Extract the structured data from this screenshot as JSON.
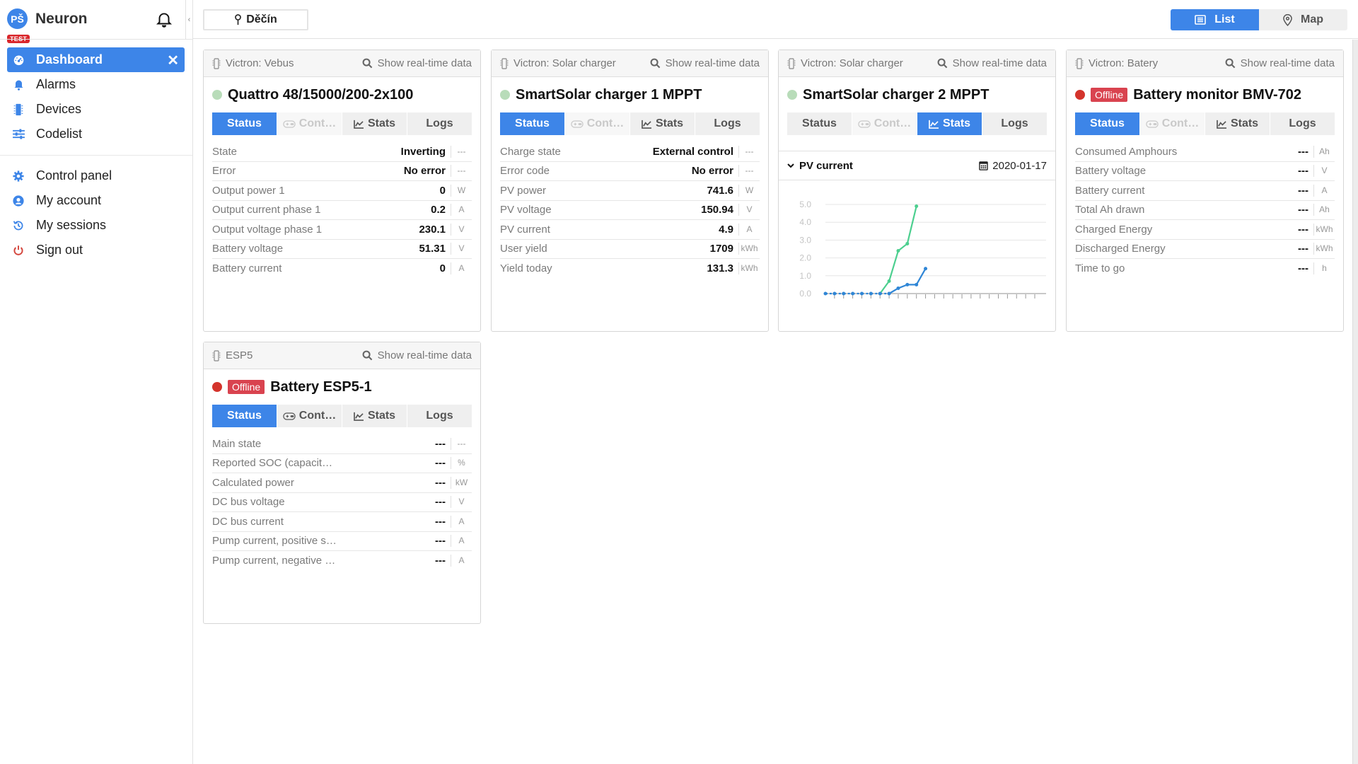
{
  "sidebar": {
    "avatar_initials": "PŠ",
    "brand": "Neuron",
    "env_badge": "TEST",
    "collapse_glyph": "‹",
    "nav_main": [
      {
        "label": "Dashboard",
        "icon": "dashboard-icon",
        "active": true,
        "close": "✕"
      },
      {
        "label": "Alarms",
        "icon": "bell-icon"
      },
      {
        "label": "Devices",
        "icon": "chip-icon"
      },
      {
        "label": "Codelist",
        "icon": "sliders-icon"
      }
    ],
    "nav_account": [
      {
        "label": "Control panel",
        "icon": "gear-icon"
      },
      {
        "label": "My account",
        "icon": "user-circle-icon"
      },
      {
        "label": "My sessions",
        "icon": "history-icon"
      },
      {
        "label": "Sign out",
        "icon": "power-icon"
      }
    ]
  },
  "topbar": {
    "location": "Děčín",
    "views": [
      {
        "label": "List",
        "active": true
      },
      {
        "label": "Map",
        "active": false
      }
    ]
  },
  "colors": {
    "accent": "#3d85e8",
    "online": "#b8dcb9",
    "offline": "#d4342c",
    "series_green": "#4ccf8f",
    "series_blue": "#2f86d6"
  },
  "realtime_label": "Show real-time data",
  "tab_labels": [
    "Status",
    "Cont…",
    "Stats",
    "Logs"
  ],
  "cards": [
    {
      "type": "Victron: Vebus",
      "name": "Quattro 48/15000/200-2x100",
      "status": "online",
      "active_tab": "Status",
      "control_enabled": false,
      "rows": [
        {
          "label": "State",
          "value": "Inverting",
          "unit": "---"
        },
        {
          "label": "Error",
          "value": "No error",
          "unit": "---"
        },
        {
          "label": "Output power 1",
          "value": "0",
          "unit": "W"
        },
        {
          "label": "Output current phase 1",
          "value": "0.2",
          "unit": "A"
        },
        {
          "label": "Output voltage phase 1",
          "value": "230.1",
          "unit": "V"
        },
        {
          "label": "Battery voltage",
          "value": "51.31",
          "unit": "V"
        },
        {
          "label": "Battery current",
          "value": "0",
          "unit": "A"
        }
      ]
    },
    {
      "type": "Victron: Solar charger",
      "name": "SmartSolar charger 1 MPPT",
      "status": "online",
      "active_tab": "Status",
      "control_enabled": false,
      "rows": [
        {
          "label": "Charge state",
          "value": "External control",
          "unit": "---"
        },
        {
          "label": "Error code",
          "value": "No error",
          "unit": "---"
        },
        {
          "label": "PV power",
          "value": "741.6",
          "unit": "W"
        },
        {
          "label": "PV voltage",
          "value": "150.94",
          "unit": "V"
        },
        {
          "label": "PV current",
          "value": "4.9",
          "unit": "A"
        },
        {
          "label": "User yield",
          "value": "1709",
          "unit": "kWh"
        },
        {
          "label": "Yield today",
          "value": "131.3",
          "unit": "kWh"
        }
      ]
    },
    {
      "type": "Victron: Solar charger",
      "name": "SmartSolar charger 2 MPPT",
      "status": "online",
      "active_tab": "Stats",
      "control_enabled": false,
      "stats": {
        "metric": "PV current",
        "date": "2020-01-17"
      }
    },
    {
      "type": "Victron: Batery",
      "name": "Battery monitor BMV-702",
      "status": "offline",
      "status_label": "Offline",
      "active_tab": "Status",
      "control_enabled": false,
      "rows": [
        {
          "label": "Consumed Amphours",
          "value": "---",
          "unit": "Ah"
        },
        {
          "label": "Battery voltage",
          "value": "---",
          "unit": "V"
        },
        {
          "label": "Battery current",
          "value": "---",
          "unit": "A"
        },
        {
          "label": "Total Ah drawn",
          "value": "---",
          "unit": "Ah"
        },
        {
          "label": "Charged Energy",
          "value": "---",
          "unit": "kWh"
        },
        {
          "label": "Discharged Energy",
          "value": "---",
          "unit": "kWh"
        },
        {
          "label": "Time to go",
          "value": "---",
          "unit": "h"
        }
      ]
    },
    {
      "type": "ESP5",
      "name": "Battery ESP5-1",
      "status": "offline",
      "status_label": "Offline",
      "active_tab": "Status",
      "control_enabled": true,
      "rows": [
        {
          "label": "Main state",
          "value": "---",
          "unit": "---"
        },
        {
          "label": "Reported SOC (capacit…",
          "value": "---",
          "unit": "%"
        },
        {
          "label": "Calculated power",
          "value": "---",
          "unit": "kW"
        },
        {
          "label": "DC bus voltage",
          "value": "---",
          "unit": "V"
        },
        {
          "label": "DC bus current",
          "value": "---",
          "unit": "A"
        },
        {
          "label": "Pump current, positive s…",
          "value": "---",
          "unit": "A"
        },
        {
          "label": "Pump current, negative …",
          "value": "---",
          "unit": "A"
        }
      ]
    }
  ],
  "chart_data": {
    "type": "line",
    "title": "PV current",
    "date": "2020-01-17",
    "xlabel": "",
    "ylabel": "",
    "x": [
      0,
      1,
      2,
      3,
      4,
      5,
      6,
      7,
      8,
      9,
      10,
      11,
      12,
      13,
      14,
      15,
      16,
      17,
      18,
      19,
      20,
      21,
      22,
      23
    ],
    "xlim": [
      0,
      23
    ],
    "ylim": [
      0,
      5
    ],
    "yticks": [
      "0.0",
      "1.0",
      "2.0",
      "3.0",
      "4.0",
      "5.0"
    ],
    "grid": true,
    "legend": "none",
    "series": [
      {
        "name": "series-green",
        "color": "#4ccf8f",
        "values": [
          null,
          null,
          null,
          null,
          null,
          null,
          0,
          0.7,
          2.4,
          2.8,
          4.9
        ]
      },
      {
        "name": "series-blue",
        "color": "#2f86d6",
        "values": [
          0,
          0,
          0,
          0,
          0,
          0,
          0,
          0,
          0.3,
          0.5,
          0.5,
          1.4
        ]
      }
    ]
  }
}
